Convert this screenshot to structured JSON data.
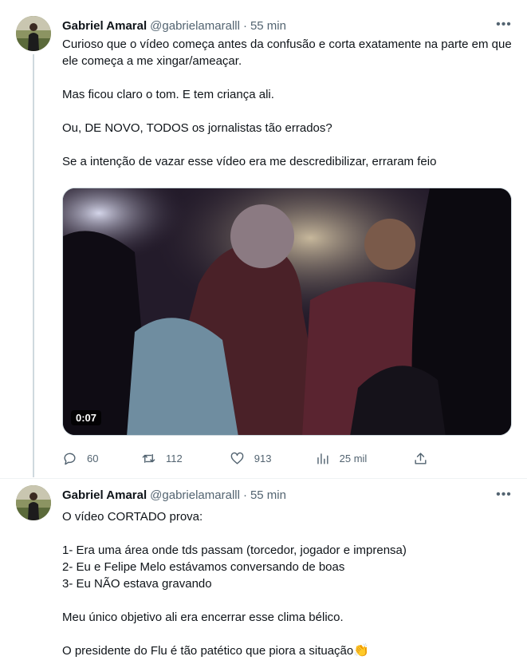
{
  "tweets": [
    {
      "author": {
        "name": "Gabriel Amaral",
        "handle": "@gabrielamaralll"
      },
      "separator": "·",
      "time": "55 min",
      "more": "•••",
      "paragraphs": [
        "Curioso que o vídeo começa antes da confusão e corta exatamente na parte em que ele começa a me xingar/ameaçar.",
        "Mas ficou claro o tom. E tem criança ali.",
        "Ou, DE NOVO, TODOS os jornalistas tão errados?",
        "Se a intenção de vazar esse vídeo era me descredibilizar, erraram feio"
      ],
      "media": {
        "duration": "0:07"
      },
      "actions": {
        "reply": {
          "icon": "reply-icon",
          "count": "60"
        },
        "retweet": {
          "icon": "retweet-icon",
          "count": "112"
        },
        "like": {
          "icon": "heart-icon",
          "count": "913"
        },
        "views": {
          "icon": "views-icon",
          "count": "25 mil"
        },
        "share": {
          "icon": "share-icon"
        }
      }
    },
    {
      "author": {
        "name": "Gabriel Amaral",
        "handle": "@gabrielamaralll"
      },
      "separator": "·",
      "time": "55 min",
      "more": "•••",
      "lines": [
        "O vídeo CORTADO prova:",
        "1- Era uma área onde tds passam (torcedor, jogador e imprensa)",
        "2- Eu e Felipe Melo estávamos conversando de boas",
        "3- Eu NÃO estava gravando",
        "Meu único objetivo ali era encerrar esse clima bélico.",
        "O presidente do Flu é tão patético que piora a situação"
      ],
      "emoji": "👏"
    }
  ],
  "colors": {
    "text": "#0f1419",
    "secondary": "#536471",
    "border": "#cfd9de",
    "thread_line": "#cfd9de"
  }
}
